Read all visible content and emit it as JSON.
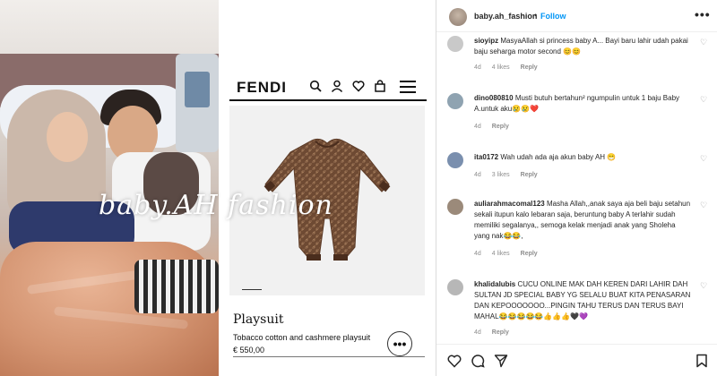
{
  "photo": {
    "watermark": "baby.AH fashion"
  },
  "product_page": {
    "brand": "FENDI",
    "icons": [
      "search-icon",
      "user-icon",
      "heart-icon",
      "bag-icon",
      "menu-icon"
    ],
    "product_name": "Playsuit",
    "product_description": "Tobacco cotton and cashmere playsuit",
    "price": "€ 550,00",
    "more_label": "•••"
  },
  "post": {
    "username": "baby.ah_fashion",
    "separator": "•",
    "follow_label": "Follow",
    "more_label": "•••",
    "comments": [
      {
        "user": "sioyipz",
        "text": "MasyaAllah si princess baby A... Bayi baru lahir udah pakai baju seharga motor second 😊😊",
        "age": "4d",
        "likes": "4 likes",
        "reply": "Reply",
        "avatar_color": "#c9c9c9"
      },
      {
        "user": "dino080810",
        "text": "Musti butuh bertahun² ngumpulin untuk 1 baju Baby A.untuk aku😢😢❤️",
        "age": "4d",
        "likes": "",
        "reply": "Reply",
        "avatar_color": "#8fa3b1"
      },
      {
        "user": "ita0172",
        "text": "Wah udah ada aja akun baby AH 😁",
        "age": "4d",
        "likes": "3 likes",
        "reply": "Reply",
        "avatar_color": "#7a8fae"
      },
      {
        "user": "auliarahmacomal123",
        "text": "Masha Allah,,anak saya aja beli baju setahun sekali itupun kalo lebaran saja, beruntung baby A terlahir sudah memiliki segalanya,, semoga kelak menjadi anak yang Sholeha yang nak😂😂,",
        "age": "4d",
        "likes": "4 likes",
        "reply": "Reply",
        "avatar_color": "#9b8a7a"
      },
      {
        "user": "khalidalubis",
        "text": "CUCU ONLINE MAK DAH KEREN DARI LAHIR DAH SULTAN JD SPECIAL BABY YG SELALU BUAT KITA PENASARAN DAN KEPOOOOOOO...PINGIN TAHU TERUS DAN TERUS BAYI MAHAL😂😂😂😂😂👍👍👍🖤💜",
        "age": "4d",
        "likes": "",
        "reply": "Reply",
        "avatar_color": "#b7b7b7"
      }
    ],
    "action_icons": [
      "heart-icon",
      "comment-icon",
      "share-icon",
      "bookmark-icon"
    ]
  }
}
